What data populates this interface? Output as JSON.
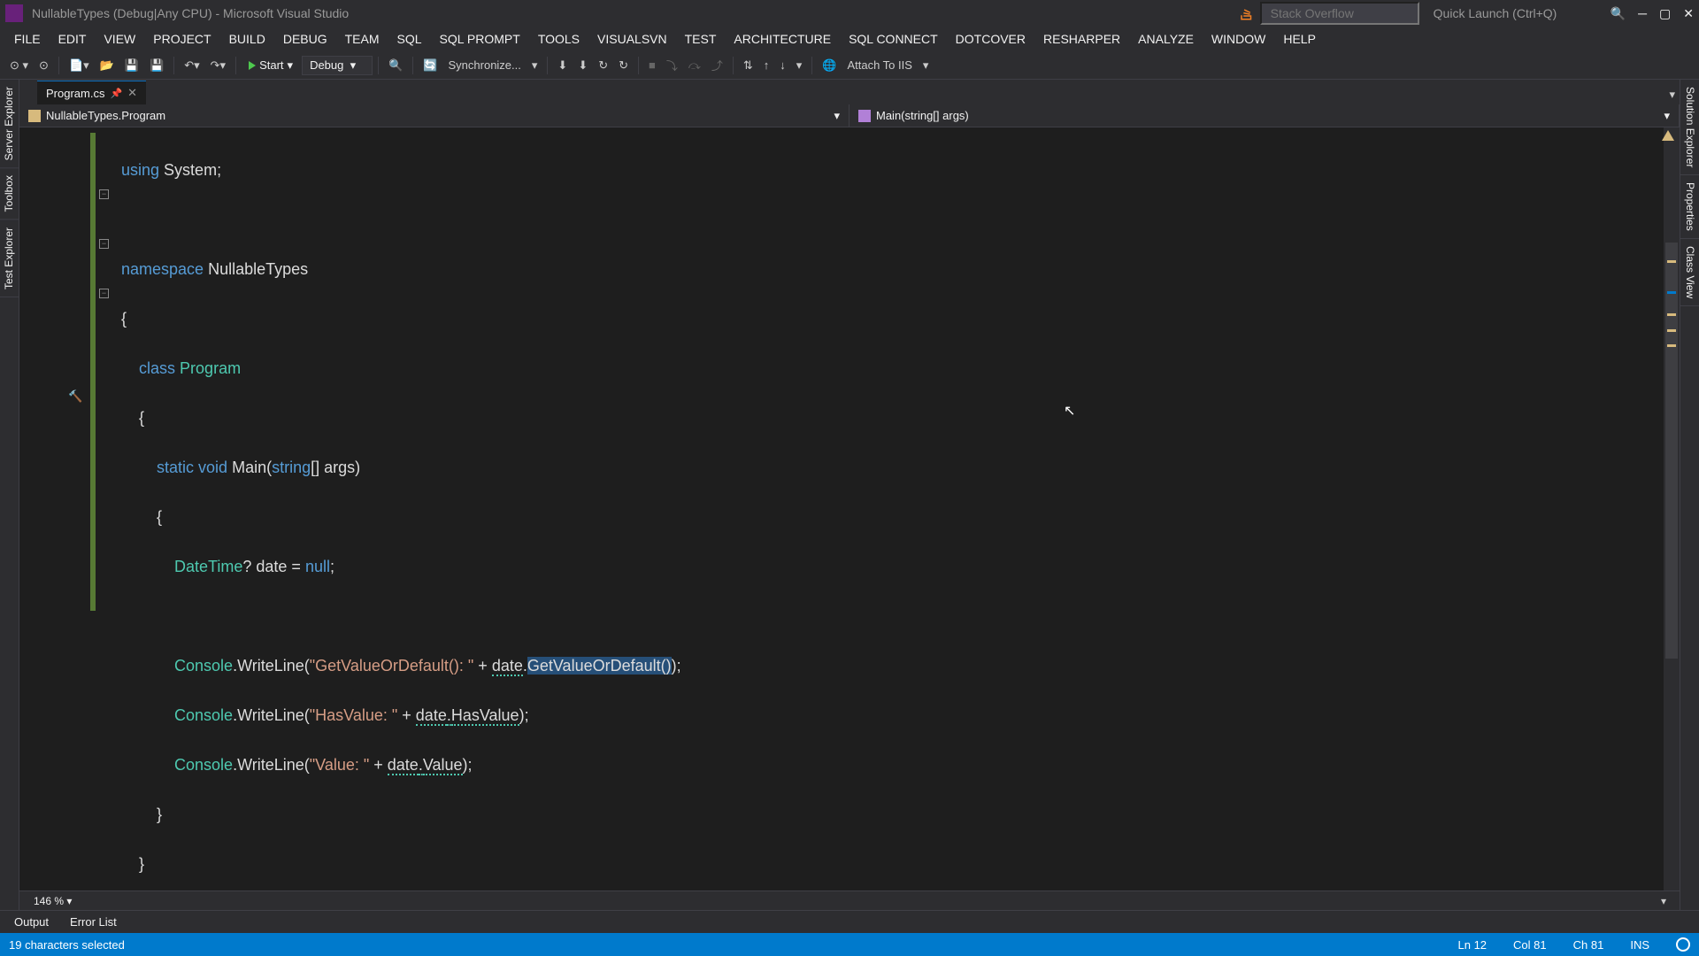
{
  "title": "NullableTypes (Debug|Any CPU) - Microsoft Visual Studio",
  "stack_overflow_placeholder": "Stack Overflow",
  "quick_launch_placeholder": "Quick Launch (Ctrl+Q)",
  "menu": [
    "FILE",
    "EDIT",
    "VIEW",
    "PROJECT",
    "BUILD",
    "DEBUG",
    "TEAM",
    "SQL",
    "SQL PROMPT",
    "TOOLS",
    "VISUALSVN",
    "TEST",
    "ARCHITECTURE",
    "SQL CONNECT",
    "DOTCOVER",
    "RESHARPER",
    "ANALYZE",
    "WINDOW",
    "HELP"
  ],
  "toolbar": {
    "start_label": "Start",
    "config": "Debug",
    "sync_label": "Synchronize...",
    "attach_label": "Attach To IIS"
  },
  "left_tabs": [
    "Server Explorer",
    "Toolbox",
    "Test Explorer"
  ],
  "right_tabs": [
    "Solution Explorer",
    "Properties",
    "Class View"
  ],
  "tab": {
    "name": "Program.cs"
  },
  "nav": {
    "class": "NullableTypes.Program",
    "member": "Main(string[] args)"
  },
  "code": {
    "using": "using",
    "system": "System",
    "namespace": "namespace",
    "ns_name": "NullableTypes",
    "class_kw": "class",
    "class_name": "Program",
    "static": "static",
    "void": "void",
    "main": "Main",
    "string": "string",
    "args": "[] args",
    "datetime": "DateTime",
    "q": "?",
    "date": " date = ",
    "null": "null",
    "console": "Console",
    "writeline": "WriteLine",
    "str1": "\"GetValueOrDefault(): \"",
    "plus": " + ",
    "datevar": "date",
    "dot": ".",
    "gvod": "GetValueOrDefault()",
    "str2": "\"HasValue: \"",
    "hasvalue": "HasValue",
    "str3": "\"Value: \"",
    "value": "Value"
  },
  "zoom": "146 %",
  "bottom_tabs": {
    "output": "Output",
    "errors": "Error List"
  },
  "status": {
    "selection": "19 characters selected",
    "ln": "Ln 12",
    "col": "Col 81",
    "ch": "Ch 81",
    "ins": "INS"
  }
}
